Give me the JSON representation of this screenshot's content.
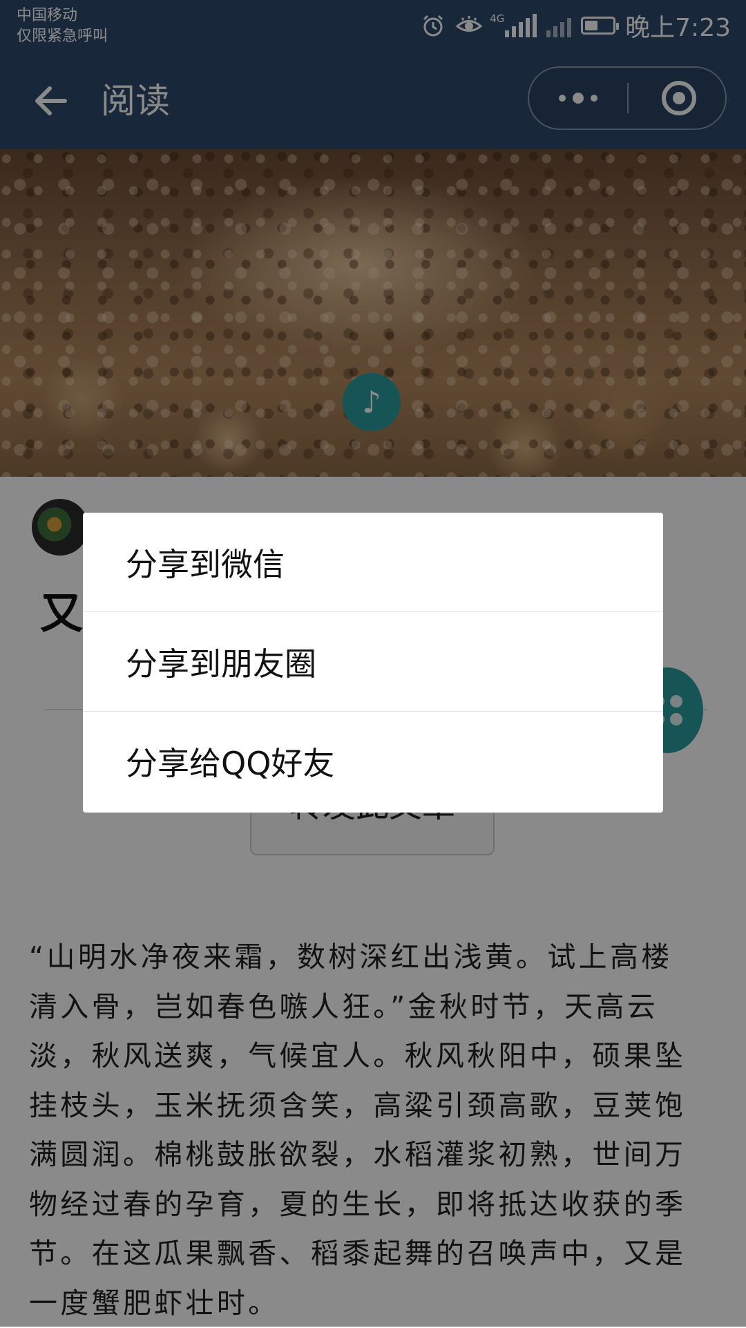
{
  "status_bar": {
    "carrier_line1": "中国移动",
    "carrier_line2": "仅限紧急呼叫",
    "network_label": "4G",
    "time": "晚上7:23",
    "icons": [
      "alarm-icon",
      "eye-icon",
      "signal-icon",
      "no-signal-icon",
      "battery-icon"
    ]
  },
  "nav": {
    "title": "阅读",
    "back_icon": "back-arrow-icon",
    "menu_icon": "more-dots-icon",
    "close_icon": "target-icon",
    "background_color": "#2e4a6b"
  },
  "hero": {
    "badge_icon": "music-note-icon",
    "badge_color": "#2a9c9f"
  },
  "article": {
    "title_visible": "又",
    "forward_button_label": "转发此文章",
    "body": "“山明水净夜来霜，数树深红出浅黄。试上高楼清入骨，岂如春色嗾人狂。”金秋时节，天高云淡，秋风送爽，气候宜人。秋风秋阳中，硕果坠挂枝头，玉米抚须含笑，高粱引颈高歌，豆荚饱满圆润。棉桃鼓胀欲裂，水稻灌浆初熟，世间万物经过春的孕育，夏的生长，即将抵达收获的季节。在这瓜果飘香、稻黍起舞的召唤声中，又是一度蟹肥虾壮时。"
  },
  "share_sheet": {
    "items": [
      {
        "label": "分享到微信"
      },
      {
        "label": "分享到朋友圈"
      },
      {
        "label": "分享给QQ好友"
      }
    ]
  }
}
